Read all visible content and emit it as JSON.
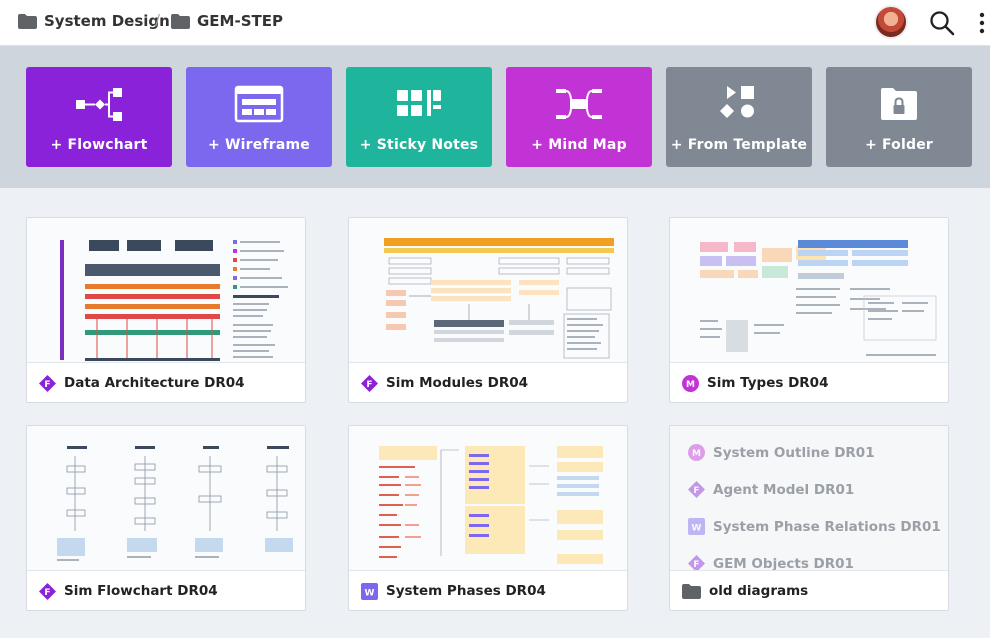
{
  "breadcrumb": {
    "root": "System Design",
    "separator": "/",
    "current": "GEM-STEP"
  },
  "create_tiles": [
    {
      "label": "+ Flowchart",
      "color": "#8a22d9",
      "icon": "flowchart-icon"
    },
    {
      "label": "+ Wireframe",
      "color": "#7b68ee",
      "icon": "wireframe-icon"
    },
    {
      "label": "+ Sticky Notes",
      "color": "#1fb49c",
      "icon": "sticky-notes-icon"
    },
    {
      "label": "+ Mind Map",
      "color": "#c233d6",
      "icon": "mind-map-icon"
    },
    {
      "label": "+ From Template",
      "color": "#7f8893",
      "icon": "shapes-template-icon"
    },
    {
      "label": "+ Folder",
      "color": "#7f8893",
      "icon": "locked-folder-icon"
    }
  ],
  "documents": [
    {
      "name": "Data Architecture DR04",
      "type": "F",
      "type_color": "#8a22d9"
    },
    {
      "name": "Sim Modules DR04",
      "type": "F",
      "type_color": "#8a22d9"
    },
    {
      "name": "Sim Types DR04",
      "type": "M",
      "type_color": "#c233d6"
    },
    {
      "name": "Sim Flowchart DR04",
      "type": "F",
      "type_color": "#8a22d9"
    },
    {
      "name": "System Phases DR04",
      "type": "W",
      "type_color": "#7b68ee"
    }
  ],
  "old_folder": {
    "name": "old diagrams",
    "items": [
      {
        "name": "System Outline DR01",
        "type": "M"
      },
      {
        "name": "Agent Model DR01",
        "type": "F"
      },
      {
        "name": "System Phase Relations DR01",
        "type": "W"
      },
      {
        "name": "GEM Objects DR01",
        "type": "F"
      }
    ]
  }
}
